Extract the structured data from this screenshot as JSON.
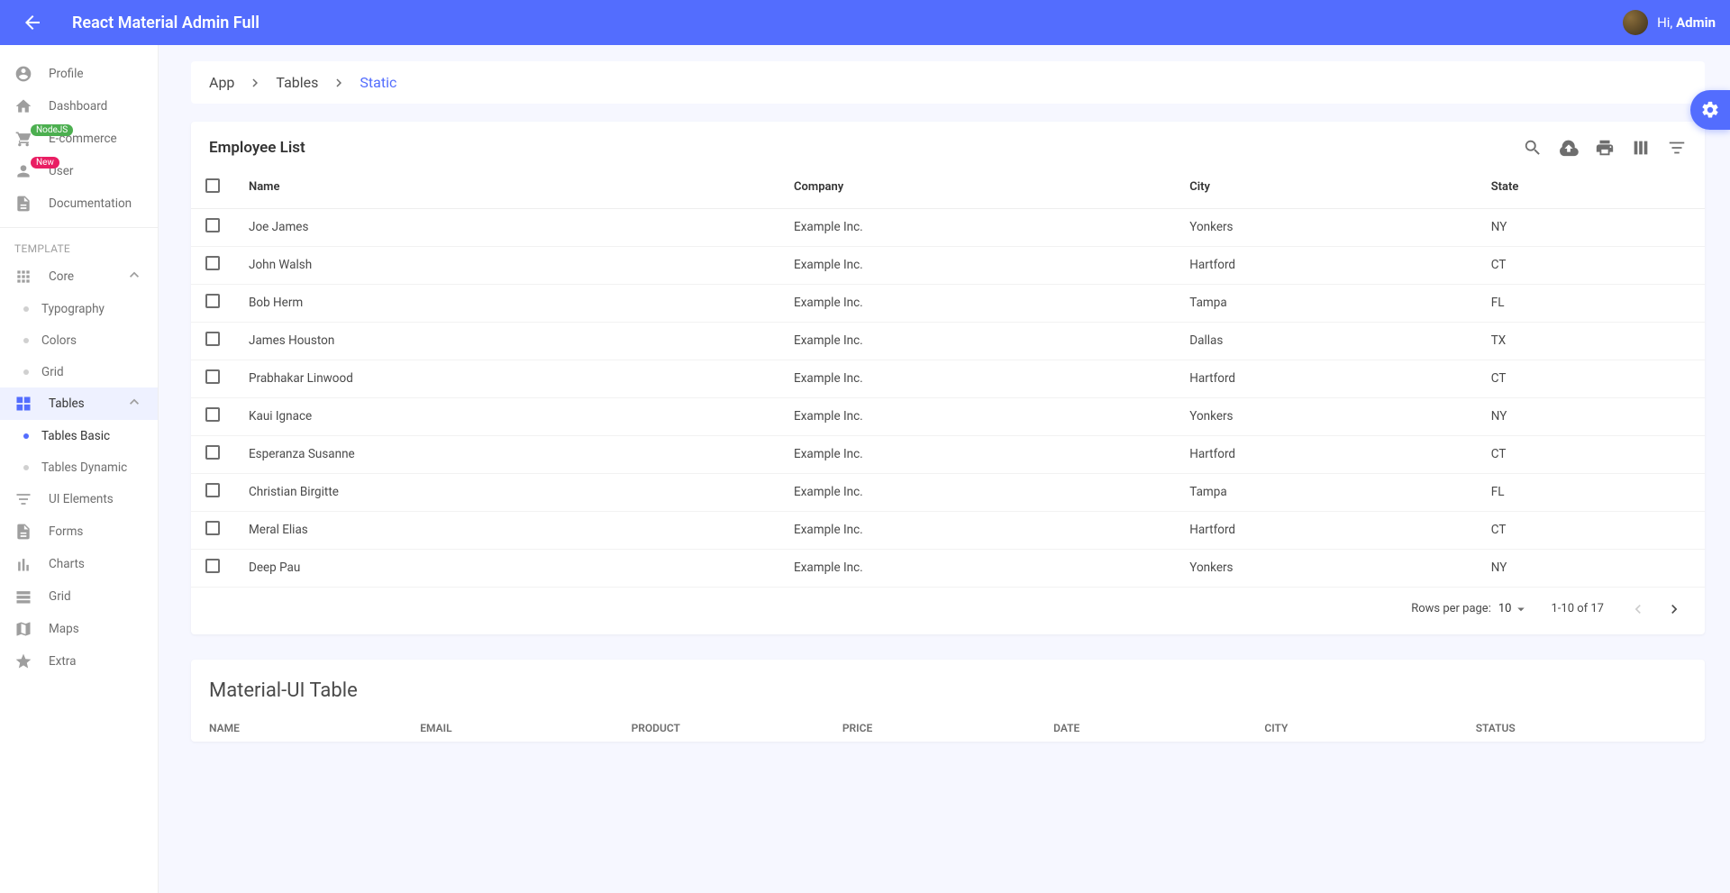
{
  "header": {
    "title": "React Material Admin Full",
    "greeting_prefix": "Hi, ",
    "greeting_name": "Admin"
  },
  "sidebar": {
    "main": [
      {
        "key": "profile",
        "label": "Profile",
        "icon": "account"
      },
      {
        "key": "dashboard",
        "label": "Dashboard",
        "icon": "home"
      },
      {
        "key": "ecommerce",
        "label": "E-commerce",
        "icon": "cart",
        "badge": {
          "text": "NodeJS",
          "color": "green"
        }
      },
      {
        "key": "user",
        "label": "User",
        "icon": "person",
        "badge": {
          "text": "New",
          "color": "pink"
        }
      },
      {
        "key": "documentation",
        "label": "Documentation",
        "icon": "doc"
      }
    ],
    "section_label": "TEMPLATE",
    "template": [
      {
        "key": "core",
        "label": "Core",
        "icon": "apps",
        "expandable": true,
        "expanded": true,
        "children": [
          {
            "key": "typography",
            "label": "Typography"
          },
          {
            "key": "colors",
            "label": "Colors"
          },
          {
            "key": "grid",
            "label": "Grid"
          }
        ]
      },
      {
        "key": "tables",
        "label": "Tables",
        "icon": "table",
        "expandable": true,
        "expanded": true,
        "active": true,
        "children": [
          {
            "key": "tables-basic",
            "label": "Tables Basic",
            "active": true
          },
          {
            "key": "tables-dynamic",
            "label": "Tables Dynamic"
          }
        ]
      },
      {
        "key": "ui-elements",
        "label": "UI Elements",
        "icon": "filter"
      },
      {
        "key": "forms",
        "label": "Forms",
        "icon": "doc"
      },
      {
        "key": "charts",
        "label": "Charts",
        "icon": "chart"
      },
      {
        "key": "grid",
        "label": "Grid",
        "icon": "gridview"
      },
      {
        "key": "maps",
        "label": "Maps",
        "icon": "map"
      },
      {
        "key": "extra",
        "label": "Extra",
        "icon": "star"
      }
    ]
  },
  "breadcrumb": {
    "items": [
      "App",
      "Tables",
      "Static"
    ]
  },
  "employee_table": {
    "title": "Employee List",
    "columns": [
      "Name",
      "Company",
      "City",
      "State"
    ],
    "rows": [
      {
        "name": "Joe James",
        "company": "Example Inc.",
        "city": "Yonkers",
        "state": "NY"
      },
      {
        "name": "John Walsh",
        "company": "Example Inc.",
        "city": "Hartford",
        "state": "CT"
      },
      {
        "name": "Bob Herm",
        "company": "Example Inc.",
        "city": "Tampa",
        "state": "FL"
      },
      {
        "name": "James Houston",
        "company": "Example Inc.",
        "city": "Dallas",
        "state": "TX"
      },
      {
        "name": "Prabhakar Linwood",
        "company": "Example Inc.",
        "city": "Hartford",
        "state": "CT"
      },
      {
        "name": "Kaui Ignace",
        "company": "Example Inc.",
        "city": "Yonkers",
        "state": "NY"
      },
      {
        "name": "Esperanza Susanne",
        "company": "Example Inc.",
        "city": "Hartford",
        "state": "CT"
      },
      {
        "name": "Christian Birgitte",
        "company": "Example Inc.",
        "city": "Tampa",
        "state": "FL"
      },
      {
        "name": "Meral Elias",
        "company": "Example Inc.",
        "city": "Hartford",
        "state": "CT"
      },
      {
        "name": "Deep Pau",
        "company": "Example Inc.",
        "city": "Yonkers",
        "state": "NY"
      }
    ],
    "footer": {
      "rpp_label": "Rows per page:",
      "rpp_value": "10",
      "range": "1-10 of 17"
    }
  },
  "mui_table": {
    "title": "Material-UI Table",
    "columns": [
      "NAME",
      "EMAIL",
      "PRODUCT",
      "PRICE",
      "DATE",
      "CITY",
      "STATUS"
    ]
  }
}
